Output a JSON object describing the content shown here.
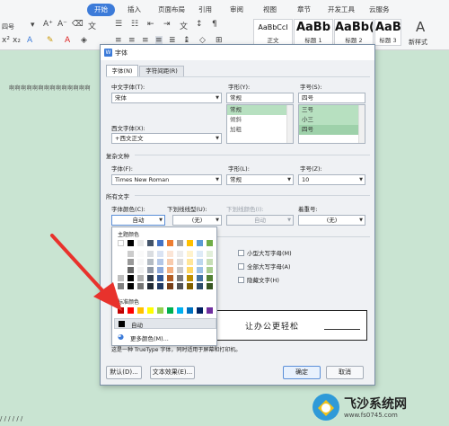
{
  "ribbon": {
    "tabs": [
      "开始",
      "插入",
      "页面布局",
      "引用",
      "审阅",
      "视图",
      "章节",
      "开发工具",
      "云服务"
    ],
    "font_size": "四号",
    "styles": [
      {
        "sample": "AaBbCcI",
        "name": "正文"
      },
      {
        "sample": "AaBb",
        "name": "标题 1"
      },
      {
        "sample": "AaBb(",
        "name": "标题 2"
      },
      {
        "sample": "AaBbC",
        "name": "标题 3"
      }
    ],
    "new_style": "新样式"
  },
  "document": {
    "text": "啊啊啊啊啊啊啊啊啊啊啊啊啊啊",
    "bottom": "/  /  /  /  /  /"
  },
  "dialog": {
    "title": "字体",
    "tabs": [
      "字体(N)",
      "字符间距(R)"
    ],
    "chinese_font_label": "中文字体(T):",
    "chinese_font": "宋体",
    "style_label": "字形(Y):",
    "style_value": "常规",
    "style_list": [
      "常规",
      "倾斜",
      "加粗"
    ],
    "size_label": "字号(S):",
    "size_value": "四号",
    "size_list": [
      "三号",
      "小三",
      "四号"
    ],
    "western_font_label": "西文字体(X):",
    "western_font": "+西文正文",
    "complex_section": "复杂文种",
    "complex_font_label": "字体(F):",
    "complex_font": "Times New Roman",
    "complex_style_label": "字形(L):",
    "complex_style": "常规",
    "complex_size_label": "字号(Z):",
    "complex_size": "10",
    "all_text_section": "所有文字",
    "font_color_label": "字体颜色(C):",
    "font_color": "自动",
    "underline_label": "下划线线型(U):",
    "underline": "(无)",
    "underline_color_label": "下划线颜色(I):",
    "underline_color": "自动",
    "emphasis_label": "着重号:",
    "emphasis": "(无)",
    "effects": [
      "小型大写字母(M)",
      "全部大写字母(A)",
      "隐藏文字(H)"
    ],
    "preview_text": "让办公更轻松",
    "note": "这是一种 TrueType 字体，同时适用于屏幕和打印机。",
    "buttons": {
      "default": "默认(D)...",
      "text_effect": "文本效果(E)...",
      "ok": "确定",
      "cancel": "取消"
    }
  },
  "color_popup": {
    "theme_label": "主题颜色",
    "standard_label": "标准颜色",
    "auto": "自动",
    "more": "更多颜色(M)...",
    "theme_colors": [
      "#ffffff",
      "#000000",
      "#e8e8e8",
      "#44546a",
      "#4472c4",
      "#ed7d31",
      "#a5a5a5",
      "#ffc000",
      "#5b9bd5",
      "#70ad47"
    ],
    "standard_colors": [
      "#c00000",
      "#ff0000",
      "#ffc000",
      "#ffff00",
      "#92d050",
      "#00b050",
      "#00b0f0",
      "#0070c0",
      "#002060",
      "#7030a0"
    ]
  },
  "colors": {
    "accent": "#3c7bd9",
    "arrow": "#e8322c",
    "selection": "#b7e0c0"
  },
  "watermark": {
    "text": "飞沙系统网",
    "url": "www.fs0745.com"
  }
}
